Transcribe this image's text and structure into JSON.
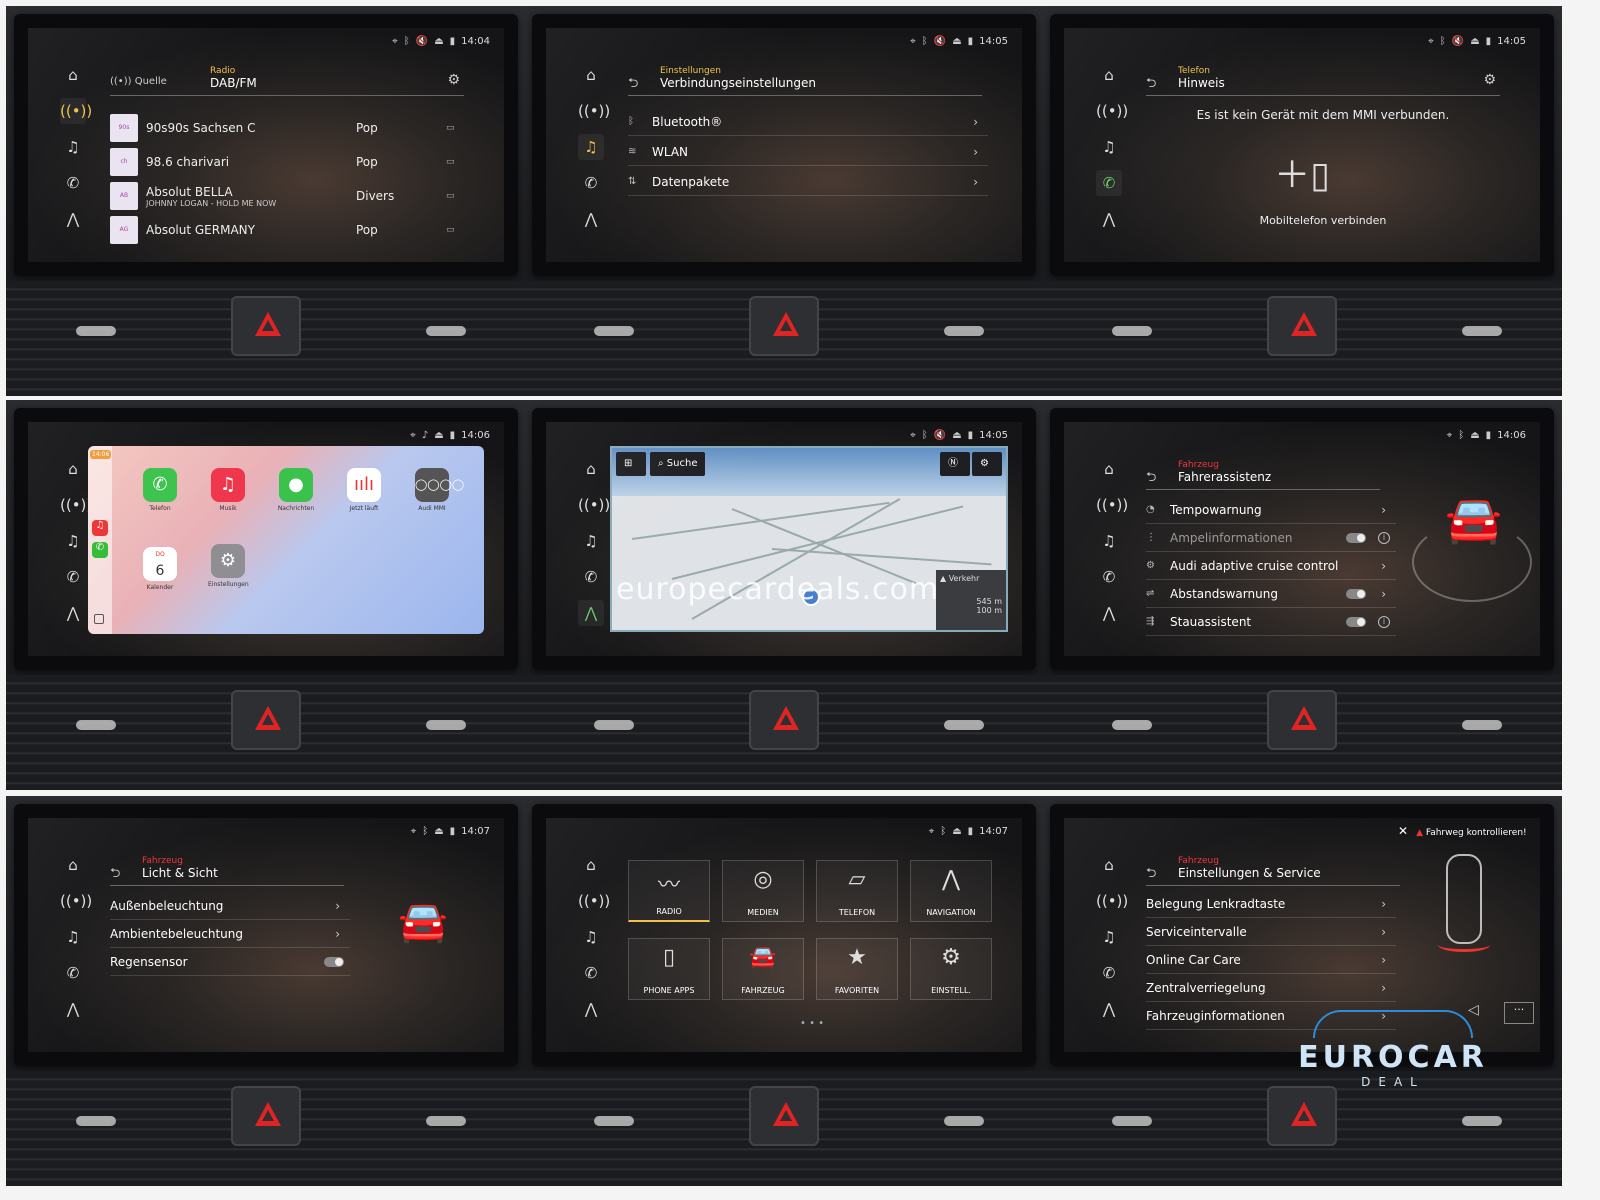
{
  "p1": {
    "time": "14:04",
    "source_label": "Quelle",
    "category": "Radio",
    "title": "DAB/FM",
    "stations": [
      {
        "name": "90s90s Sachsen C",
        "sub": "",
        "genre": "Pop"
      },
      {
        "name": "98.6 charivari",
        "sub": "",
        "genre": "Pop"
      },
      {
        "name": "Absolut BELLA",
        "sub": "JOHNNY LOGAN - HOLD ME NOW",
        "genre": "Divers"
      },
      {
        "name": "Absolut GERMANY",
        "sub": "",
        "genre": "Pop"
      }
    ]
  },
  "p2": {
    "time": "14:05",
    "category": "Einstellungen",
    "title": "Verbindungseinstellungen",
    "items": [
      "Bluetooth®",
      "WLAN",
      "Datenpakete"
    ]
  },
  "p3": {
    "time": "14:05",
    "category": "Telefon",
    "title": "Hinweis",
    "message": "Es ist kein Gerät mit dem MMI verbunden.",
    "connect_label": "Mobiltelefon verbinden"
  },
  "p4": {
    "time": "14:06",
    "side_clock": "14:06",
    "apps": [
      "Telefon",
      "Musik",
      "Nachrichten",
      "Jetzt läuft",
      "Audi MMI"
    ],
    "apps2": [
      "Kalender",
      "Einstellungen"
    ],
    "calendar_day": "6",
    "calendar_dow": "DO"
  },
  "p5": {
    "time": "14:05",
    "search_label": "Suche",
    "traffic_label": "Verkehr",
    "dist1": "545 m",
    "dist2": "100 m",
    "watermark": "europecardeals.com"
  },
  "p6": {
    "time": "14:06",
    "category": "Fahrzeug",
    "title": "Fahrerassistenz",
    "items": [
      "Tempowarnung",
      "Ampelinformationen",
      "Audi adaptive cruise control",
      "Abstandswarnung",
      "Stauassistent"
    ]
  },
  "p7": {
    "time": "14:07",
    "category": "Fahrzeug",
    "title": "Licht & Sicht",
    "items": [
      "Außenbeleuchtung",
      "Ambientebeleuchtung",
      "Regensensor"
    ]
  },
  "p8": {
    "time": "14:07",
    "tiles": [
      "RADIO",
      "MEDIEN",
      "TELEFON",
      "NAVIGATION",
      "PHONE APPS",
      "FAHRZEUG",
      "FAVORITEN",
      "EINSTELL."
    ]
  },
  "p9": {
    "category": "Fahrzeug",
    "title": "Einstellungen & Service",
    "warning": "Fahrweg kontrollieren!",
    "items": [
      "Belegung Lenkradtaste",
      "Serviceintervalle",
      "Online Car Care",
      "Zentralverriegelung",
      "Fahrzeuginformationen"
    ]
  },
  "brand": {
    "name": "EUROCAR",
    "sub": "DEAL"
  },
  "colors": {
    "accent": "#f0c04a",
    "hazard": "#e02424",
    "brand_blue": "#2e8bd6"
  }
}
